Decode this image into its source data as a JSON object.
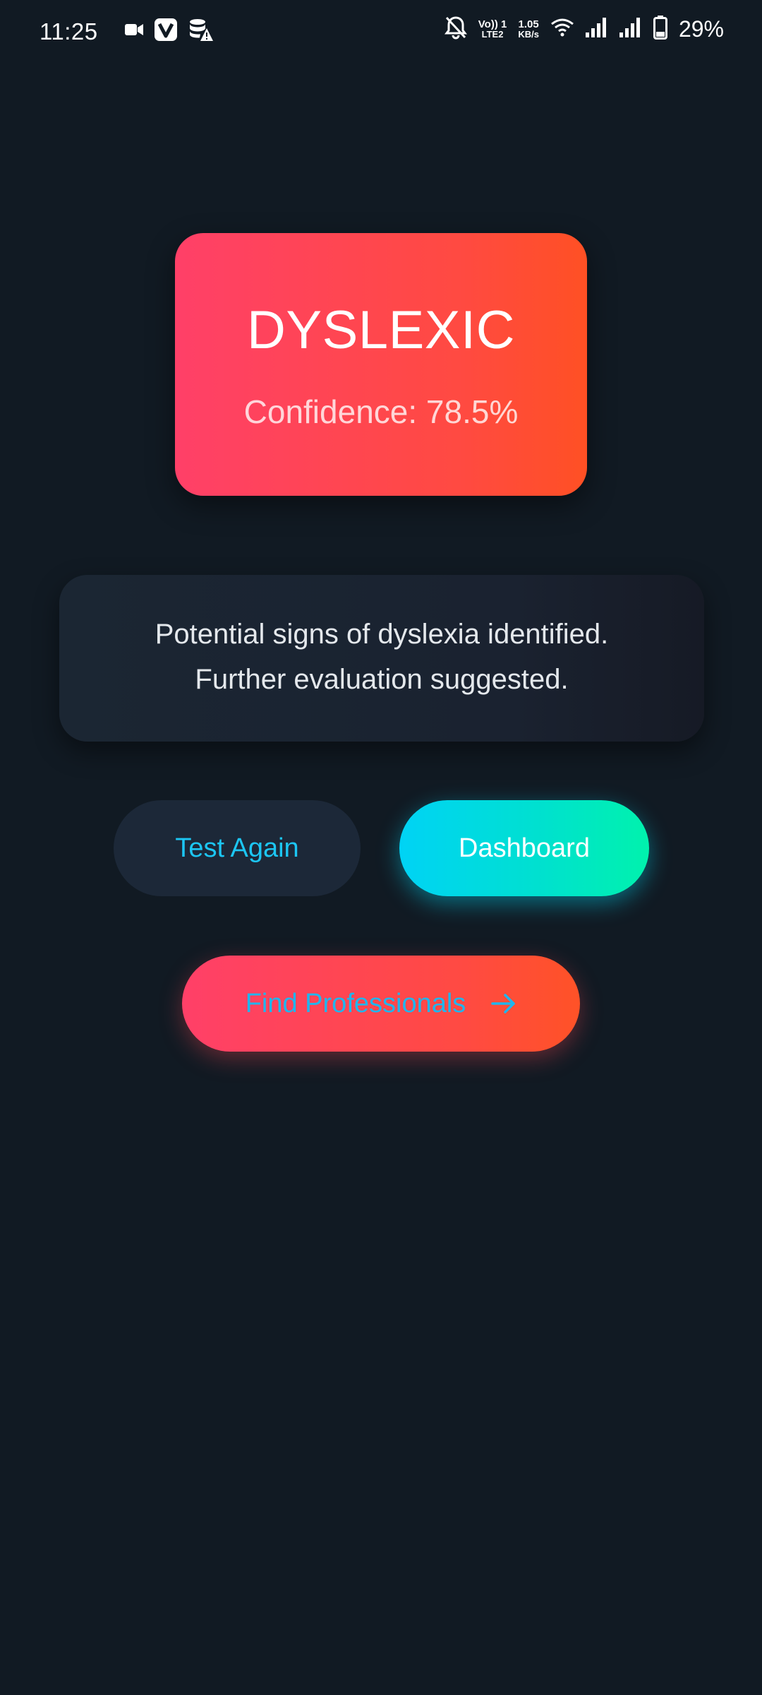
{
  "status_bar": {
    "time": "11:25",
    "left_icons": [
      "video-camera-icon",
      "v-app-icon",
      "database-warning-icon"
    ],
    "right_icons": [
      "bell-off-icon",
      "volte-lte2-icon",
      "data-speed-indicator",
      "wifi-icon",
      "signal-1-icon",
      "signal-2-icon",
      "battery-icon"
    ],
    "volte_top": "Vo)) 1",
    "volte_bottom": "LTE2",
    "speed_value": "1.05",
    "speed_unit": "KB/s",
    "battery_percent": "29%"
  },
  "result": {
    "label": "DYSLEXIC",
    "confidence_text": "Confidence: 78.5%",
    "colors": {
      "gradient_start": "#ff4068",
      "gradient_end": "#ff5024"
    }
  },
  "message": {
    "line1": "Potential signs of dyslexia identified.",
    "line2": "Further evaluation suggested."
  },
  "actions": {
    "test_again_label": "Test Again",
    "dashboard_label": "Dashboard",
    "find_professionals_label": "Find Professionals",
    "find_professionals_icon": "arrow-right-icon"
  },
  "colors": {
    "background": "#111a23",
    "accent_cyan": "#1cc6f3",
    "accent_green": "#00f2ad",
    "accent_red": "#ff4a41"
  }
}
